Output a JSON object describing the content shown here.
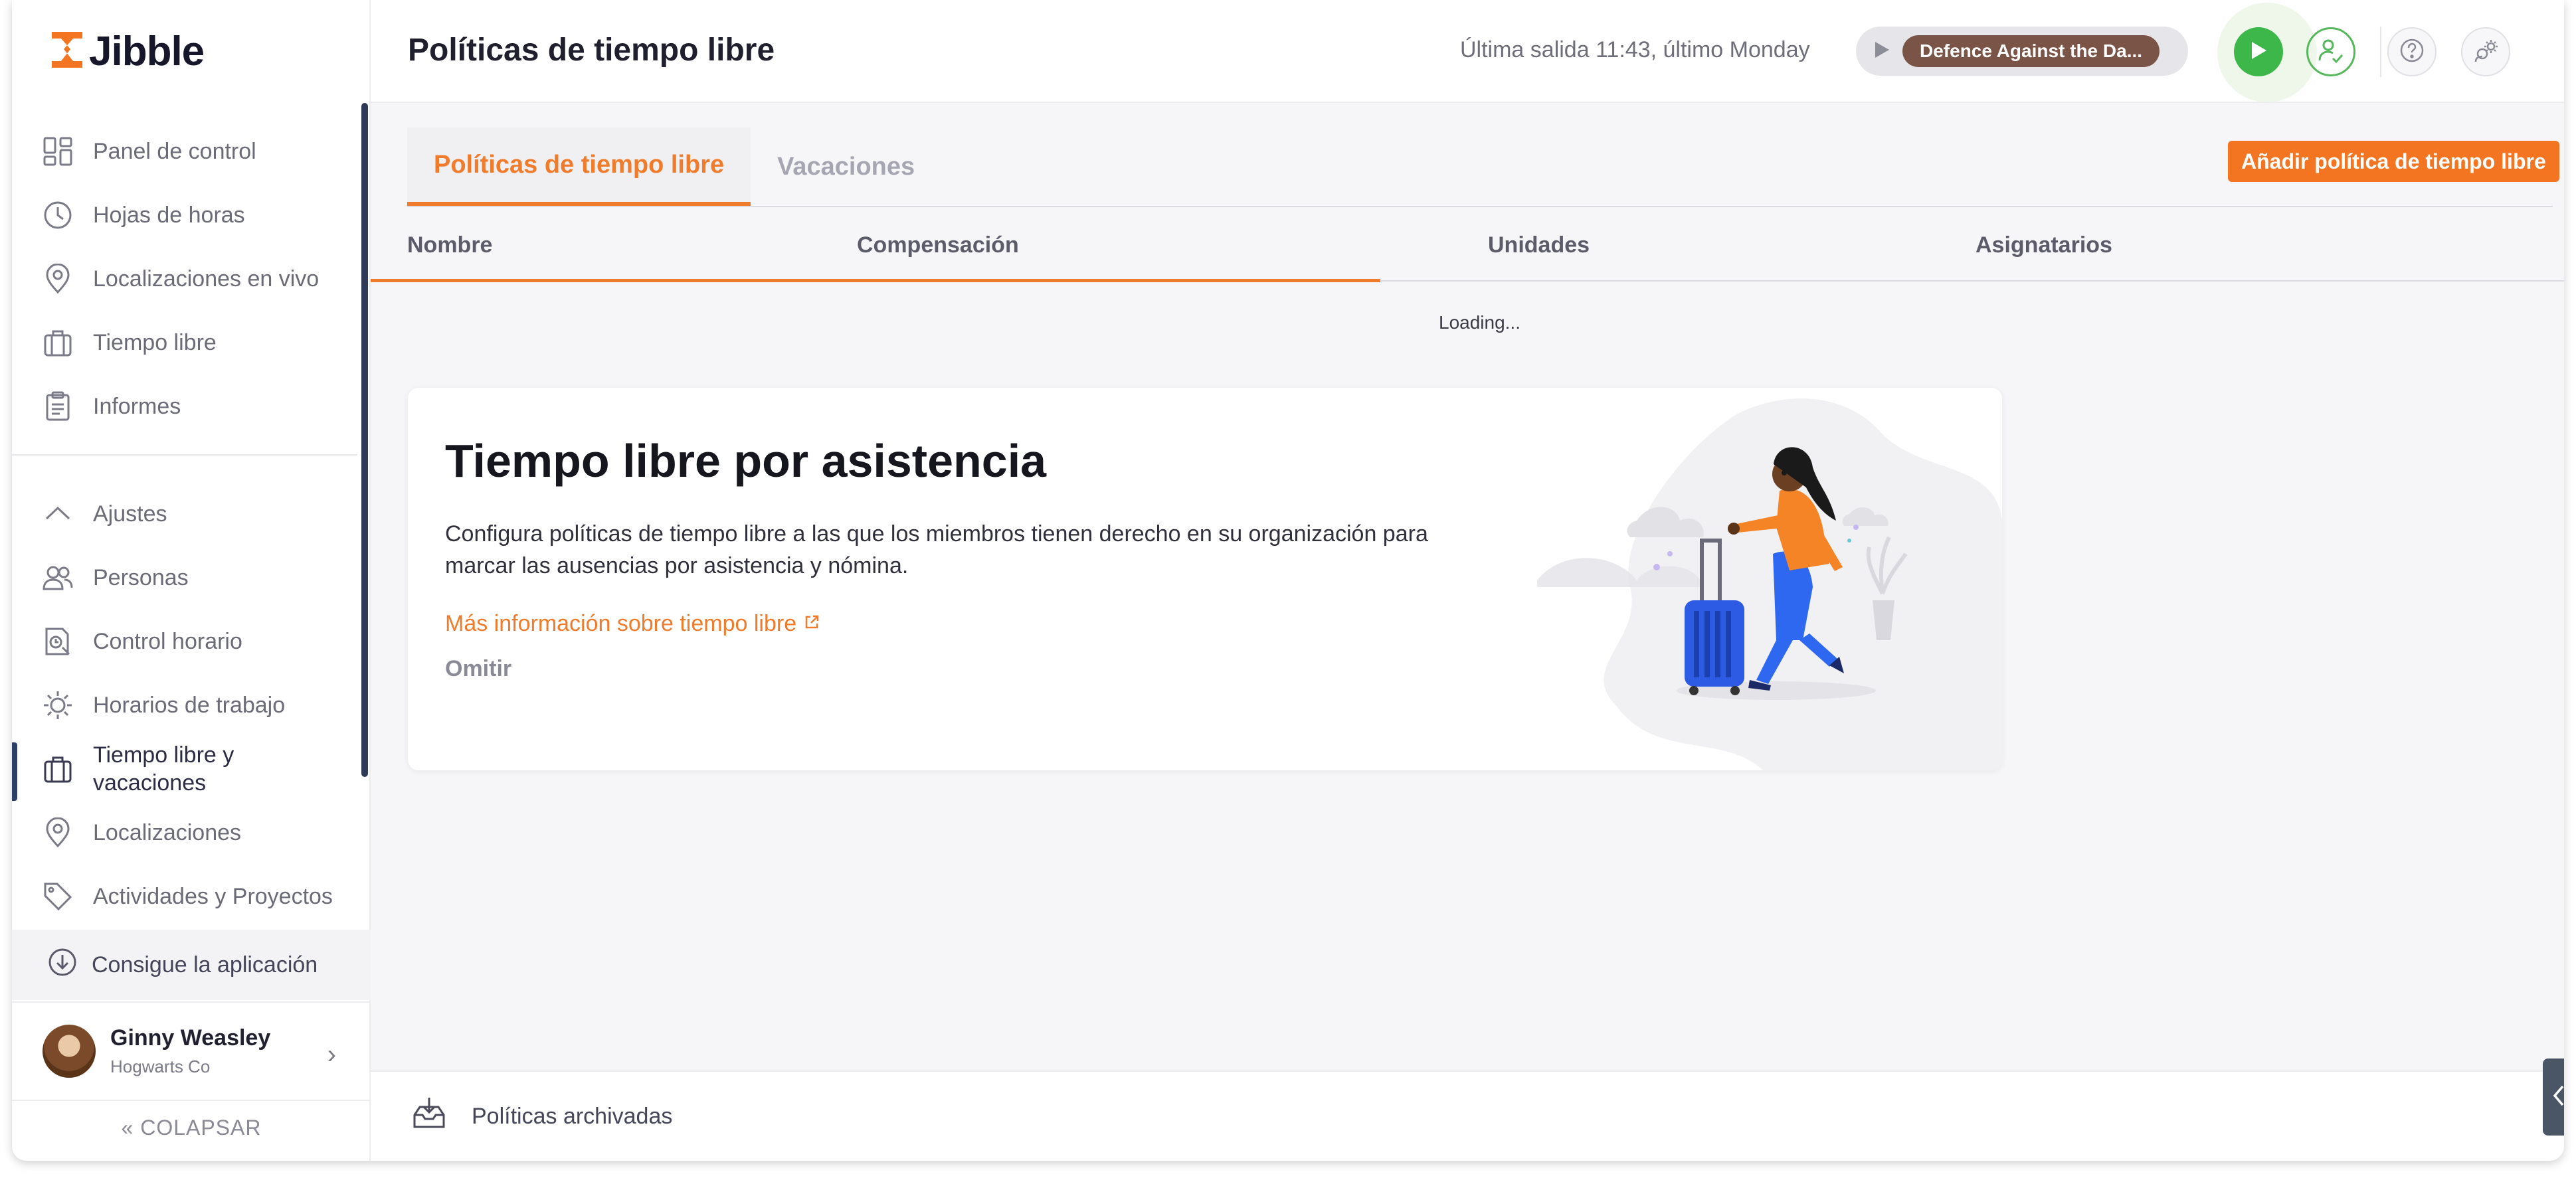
{
  "app": {
    "logo_text": "Jibble",
    "brand_color": "#f47521"
  },
  "header": {
    "title": "Políticas de tiempo libre",
    "last_out": "Última salida 11:43, último Monday",
    "project_label": "Defence Against the Da...",
    "icons": [
      "play-icon",
      "timer-play-icon",
      "user-check-icon",
      "help-icon",
      "settings-icon"
    ]
  },
  "sidebar": {
    "items": [
      {
        "label": "Panel de control",
        "icon": "dashboard-icon"
      },
      {
        "label": "Hojas de horas",
        "icon": "clock-icon"
      },
      {
        "label": "Localizaciones en vivo",
        "icon": "location-pin-icon"
      },
      {
        "label": "Tiempo libre",
        "icon": "suitcase-icon"
      },
      {
        "label": "Informes",
        "icon": "clipboard-icon"
      }
    ],
    "settings_items": [
      {
        "label": "Ajustes",
        "icon": "chevron-up-icon"
      },
      {
        "label": "Personas",
        "icon": "people-icon"
      },
      {
        "label": "Control horario",
        "icon": "time-tracking-icon"
      },
      {
        "label": "Horarios de trabajo",
        "icon": "schedule-icon"
      },
      {
        "label": "Tiempo libre y vacaciones",
        "icon": "suitcase-icon",
        "active": true
      },
      {
        "label": "Localizaciones",
        "icon": "location-pin-icon"
      },
      {
        "label": "Actividades y Proyectos",
        "icon": "tag-icon"
      }
    ],
    "get_app": "Consigue la aplicación",
    "user": {
      "name": "Ginny Weasley",
      "org": "Hogwarts Co"
    },
    "collapse": "COLAPSAR"
  },
  "main": {
    "tabs": [
      {
        "label": "Políticas de tiempo libre",
        "active": true
      },
      {
        "label": "Vacaciones",
        "active": false
      }
    ],
    "add_button": "Añadir política de tiempo libre",
    "columns": [
      "Nombre",
      "Compensación",
      "Unidades",
      "Asignatarios"
    ],
    "loading": "Loading...",
    "card": {
      "title": "Tiempo libre por asistencia",
      "description": "Configura políticas de tiempo libre a las que los miembros tienen derecho en su organización para marcar las ausencias por asistencia y nómina.",
      "link": "Más información sobre tiempo libre",
      "skip": "Omitir"
    }
  },
  "footer": {
    "archived": "Políticas archivadas"
  }
}
